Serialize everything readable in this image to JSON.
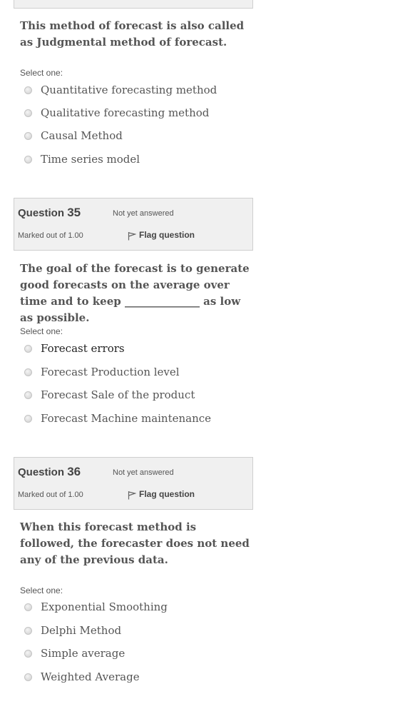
{
  "q34": {
    "text": "This method of forecast is also called as Judgmental method of forecast.",
    "select_label": "Select one:",
    "options": [
      "Quantitative forecasting method",
      "Qualitative forecasting method",
      "Causal Method",
      "Time series model"
    ]
  },
  "q35": {
    "label": "Question",
    "number": "35",
    "state": "Not yet answered",
    "marks": "Marked out of 1.00",
    "flag_label": "Flag question",
    "text": "The goal of the forecast is to generate good forecasts on the average over time and to keep ______________ as low as possible.",
    "select_label": "Select one:",
    "options": [
      "Forecast errors",
      "Forecast Production level",
      "Forecast Sale of the product",
      "Forecast Machine maintenance"
    ]
  },
  "q36": {
    "label": "Question",
    "number": "36",
    "state": "Not yet answered",
    "marks": "Marked out of 1.00",
    "flag_label": "Flag question",
    "text": "When this forecast method is followed, the forecaster does not need any of the previous data.",
    "select_label": "Select one:",
    "options": [
      "Exponential Smoothing",
      "Delphi Method",
      "Simple average",
      "Weighted Average"
    ]
  },
  "icons": {
    "flag": "flag-icon",
    "radio": "radio-button-unchecked"
  }
}
